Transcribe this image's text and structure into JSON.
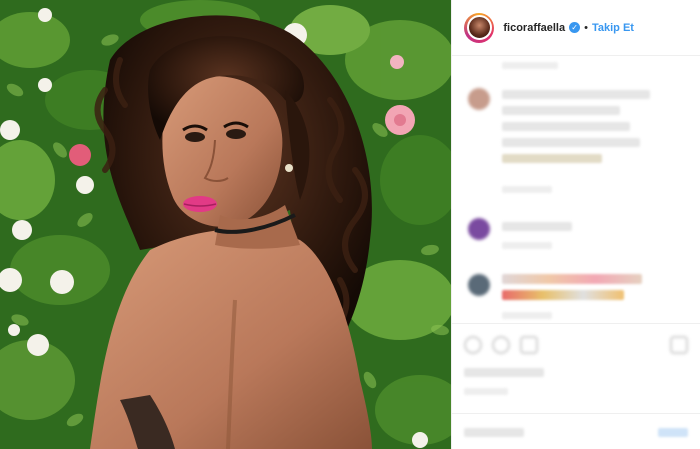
{
  "post": {
    "header": {
      "username": "ficoraffaella",
      "verified_icon": "verified-check-icon",
      "separator": "•",
      "follow_label": "Takip Et"
    },
    "colors": {
      "follow_blue": "#3897f0",
      "verified_blue": "#3897f0",
      "text_dark": "#262626",
      "border": "#efefef"
    },
    "photo": {
      "description_icon": "portrait-photo"
    }
  }
}
